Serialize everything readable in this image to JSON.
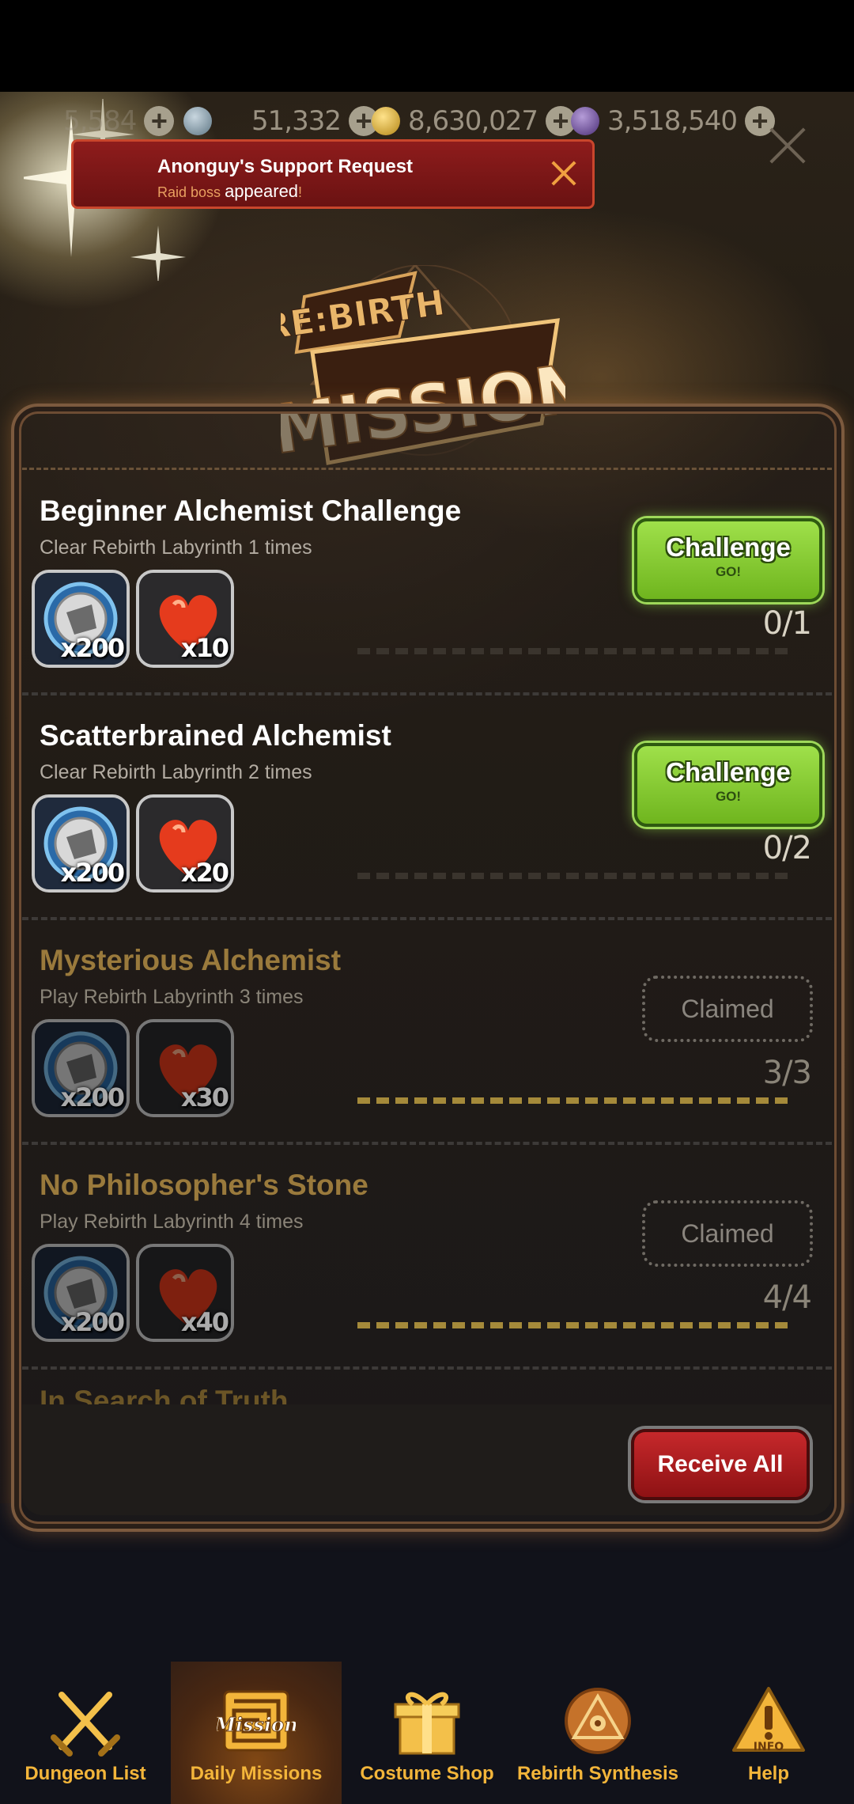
{
  "currencies": [
    {
      "icon": "stamina-icon",
      "value": "5,584"
    },
    {
      "icon": "gem-icon",
      "value": "51,332"
    },
    {
      "icon": "gold-icon",
      "value": "8,630,027"
    },
    {
      "icon": "soul-icon",
      "value": "3,518,540"
    }
  ],
  "notification": {
    "title": "Anonguy's Support Request",
    "subtitle_prefix": "Raid boss",
    "subtitle_highlight": "appeared",
    "subtitle_suffix": "!"
  },
  "logo": {
    "line1": "RE:BIRTH",
    "line2": "MISSION"
  },
  "missions": [
    {
      "title": "Beginner Alchemist Challenge",
      "desc": "Clear Rebirth Labyrinth 1 times",
      "rewards": [
        {
          "icon": "ticket-icon",
          "qty": "x200"
        },
        {
          "icon": "heart-icon",
          "qty": "x10"
        }
      ],
      "button": "Challenge",
      "button_sub": "GO!",
      "progress": "0/1",
      "fraction": 0,
      "claimed": false
    },
    {
      "title": "Scatterbrained Alchemist",
      "desc": "Clear Rebirth Labyrinth 2 times",
      "rewards": [
        {
          "icon": "ticket-icon",
          "qty": "x200"
        },
        {
          "icon": "heart-icon",
          "qty": "x20"
        }
      ],
      "button": "Challenge",
      "button_sub": "GO!",
      "progress": "0/2",
      "fraction": 0,
      "claimed": false
    },
    {
      "title": "Mysterious Alchemist",
      "desc": "Play Rebirth Labyrinth 3 times",
      "rewards": [
        {
          "icon": "ticket-icon",
          "qty": "x200"
        },
        {
          "icon": "heart-icon",
          "qty": "x30"
        }
      ],
      "button": "Claimed",
      "button_sub": "",
      "progress": "3/3",
      "fraction": 1,
      "claimed": true
    },
    {
      "title": "No Philosopher's Stone",
      "desc": "Play Rebirth Labyrinth 4 times",
      "rewards": [
        {
          "icon": "ticket-icon",
          "qty": "x200"
        },
        {
          "icon": "heart-icon",
          "qty": "x40"
        }
      ],
      "button": "Claimed",
      "button_sub": "",
      "progress": "4/4",
      "fraction": 1,
      "claimed": true
    }
  ],
  "next_mission_title_partial": "In Search of Truth",
  "receive_all_label": "Receive All",
  "nav": [
    {
      "label": "Dungeon List",
      "icon": "crossed-swords-icon",
      "active": false
    },
    {
      "label": "Daily Missions",
      "icon": "mission-maze-icon",
      "active": true
    },
    {
      "label": "Costume Shop",
      "icon": "gift-icon",
      "active": false
    },
    {
      "label": "Rebirth Synthesis",
      "icon": "synthesis-emblem-icon",
      "active": false
    },
    {
      "label": "Help",
      "icon": "info-icon",
      "active": false
    }
  ],
  "colors": {
    "accent_gold": "#f3b53a",
    "challenge_green": "#8ad23a",
    "receive_red": "#c6282b",
    "claimed_title": "#9a7a3c"
  }
}
